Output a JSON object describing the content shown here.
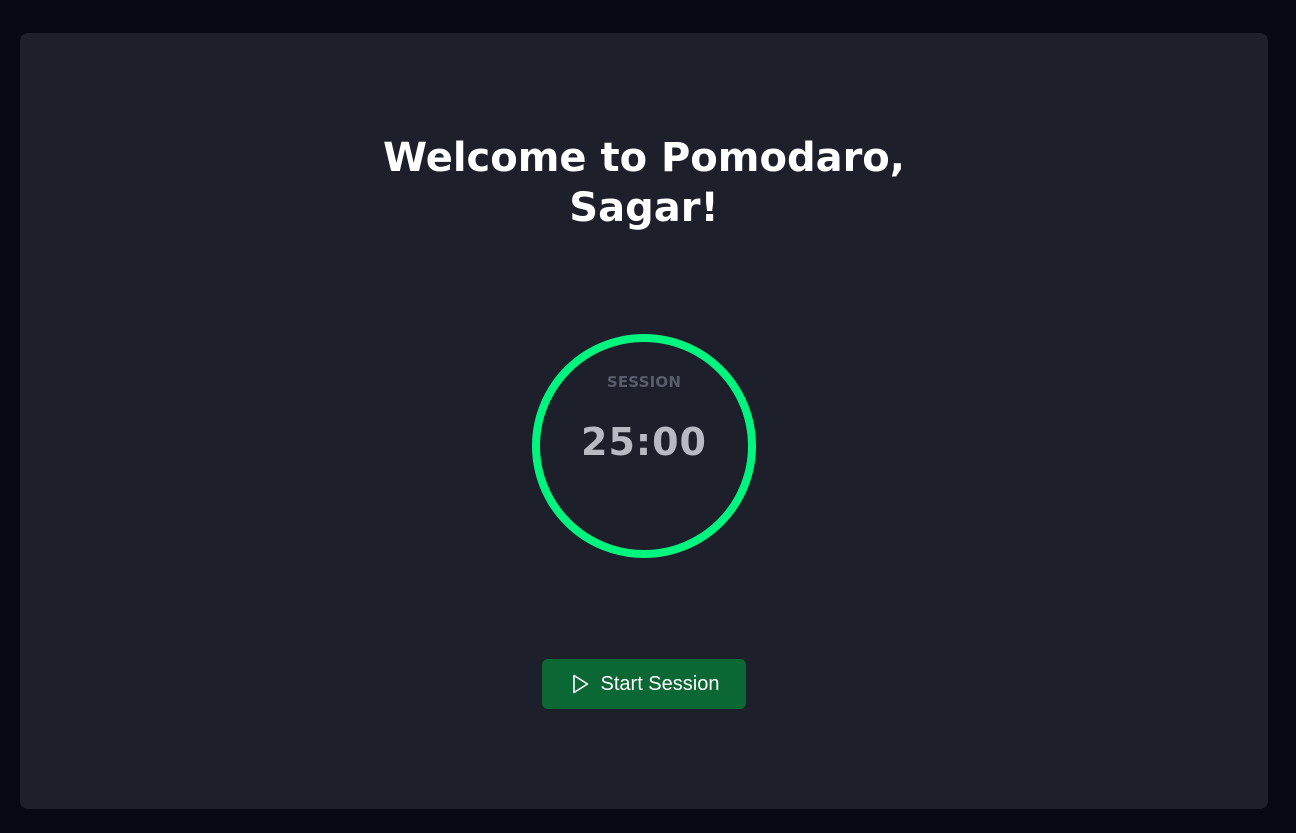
{
  "welcome": {
    "line1": "Welcome to Pomodaro,",
    "line2": "Sagar!"
  },
  "timer": {
    "label": "SESSION",
    "time": "25:00",
    "progress": 1.0
  },
  "start_button": {
    "label": "Start Session",
    "icon": "play-icon"
  },
  "colors": {
    "background": "#060913",
    "card": "#1d1f2a",
    "ring": "#00f57e",
    "button": "#0b6733",
    "label": "#585c6c",
    "time": "#b8bac3"
  }
}
